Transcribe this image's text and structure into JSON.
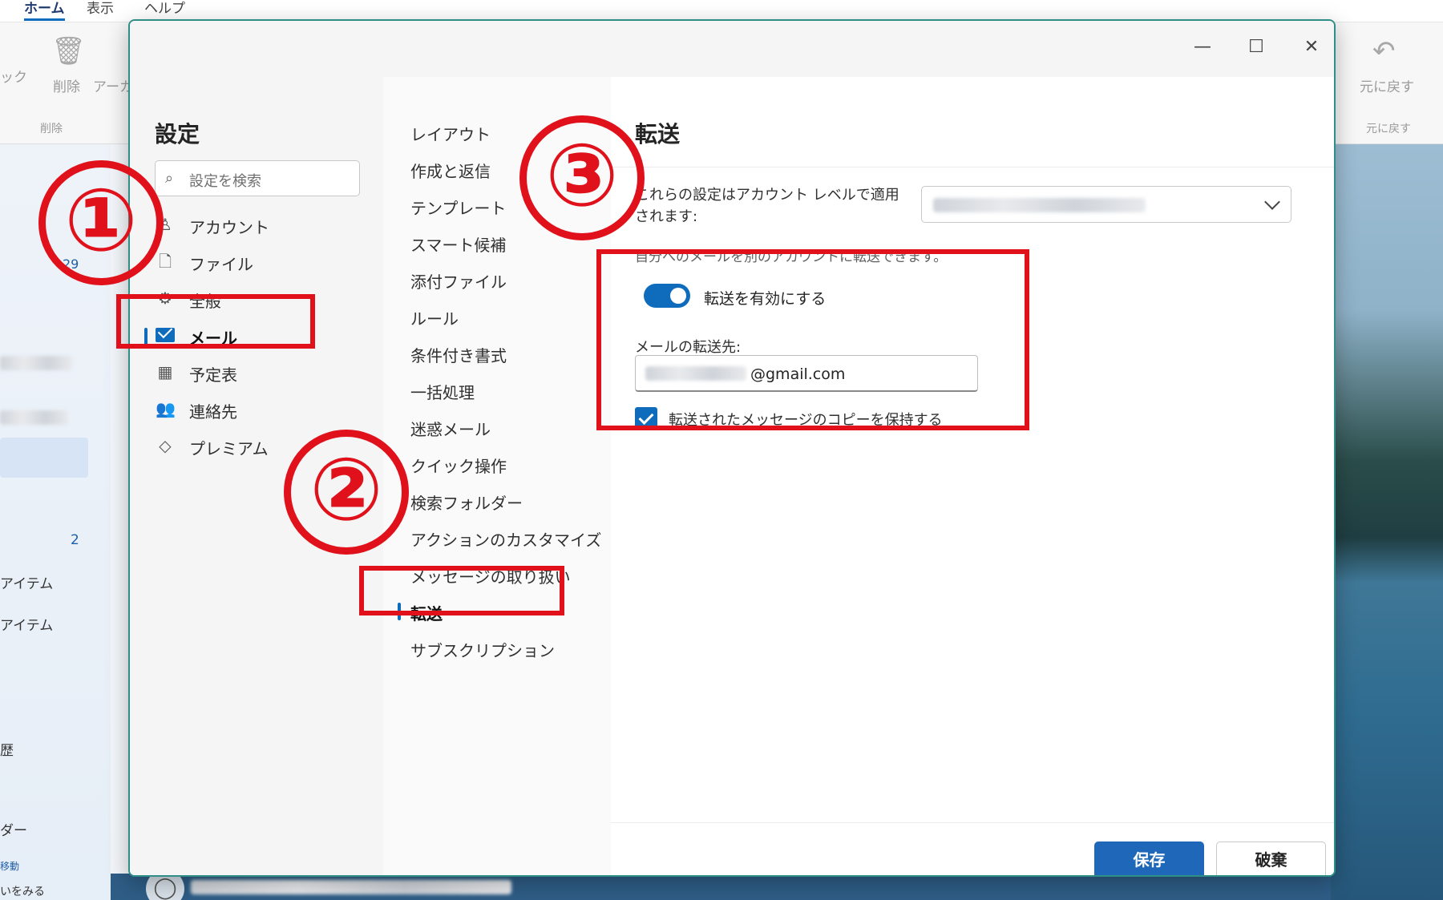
{
  "background": {
    "menu_tabs": [
      "ホーム",
      "表示",
      "ヘルプ"
    ],
    "ribbon": {
      "left_partial_label": "ック",
      "delete_label": "削除",
      "archive_partial_label": "アーカ",
      "group_label": "削除",
      "undo_label": "元に戻す",
      "undo_group_label": "元に戻す"
    },
    "left_panel": {
      "count_1": "29",
      "count_2": "2",
      "item_1": "アイテム",
      "item_2": "アイテム",
      "partial_1": "歴",
      "partial_2": "ダー",
      "partial_3": "移動",
      "partial_4": "いをみる"
    }
  },
  "dialog": {
    "settings_title": "設定",
    "search_placeholder": "設定を検索",
    "nav1": [
      {
        "label": "アカウント",
        "icon": "person-icon"
      },
      {
        "label": "ファイル",
        "icon": "file-icon"
      },
      {
        "label": "全般",
        "icon": "gear-icon"
      },
      {
        "label": "メール",
        "icon": "mail-icon",
        "selected": true
      },
      {
        "label": "予定表",
        "icon": "calendar-icon"
      },
      {
        "label": "連絡先",
        "icon": "people-icon"
      },
      {
        "label": "プレミアム",
        "icon": "diamond-icon"
      }
    ],
    "nav2": [
      {
        "label": "レイアウト"
      },
      {
        "label": "作成と返信"
      },
      {
        "label": "テンプレート"
      },
      {
        "label": "スマート候補"
      },
      {
        "label": "添付ファイル"
      },
      {
        "label": "ルール"
      },
      {
        "label": "条件付き書式"
      },
      {
        "label": "一括処理"
      },
      {
        "label": "迷惑メール"
      },
      {
        "label": "クイック操作"
      },
      {
        "label": "検索フォルダー"
      },
      {
        "label": "アクションのカスタマイズ"
      },
      {
        "label": "メッセージの取り扱い"
      },
      {
        "label": "転送",
        "selected": true
      },
      {
        "label": "サブスクリプション"
      }
    ],
    "content": {
      "title": "転送",
      "account_level_note": "これらの設定はアカウント レベルで適用されます:",
      "description": "自分へのメールを別のアカウントに転送できます。",
      "toggle_label": "転送を有効にする",
      "toggle_on": true,
      "forward_to_label": "メールの転送先:",
      "email_suffix": "@gmail.com",
      "keep_copy_label": "転送されたメッセージのコピーを保持する",
      "keep_copy_checked": true,
      "save_label": "保存",
      "discard_label": "破棄"
    }
  },
  "annotations": {
    "step_1": "①",
    "step_2": "②",
    "step_3": "③",
    "color": "#e0111b"
  }
}
